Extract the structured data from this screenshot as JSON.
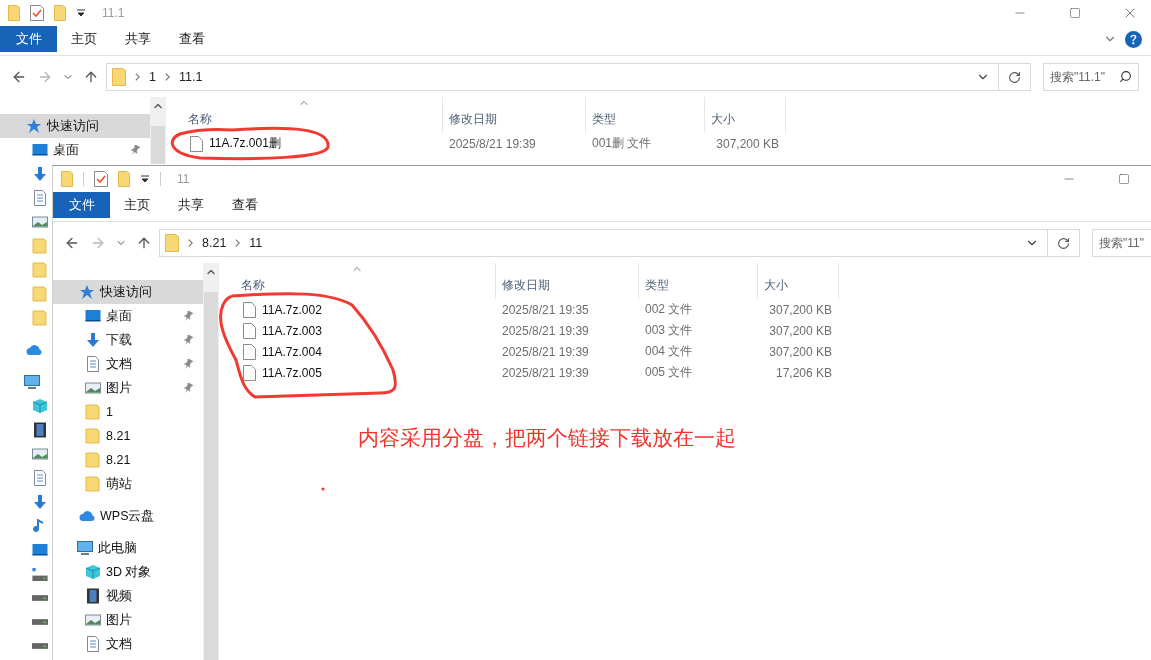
{
  "back_window": {
    "title": "11.1",
    "ribbon_tabs": [
      {
        "label": "文件",
        "selected": true
      },
      {
        "label": "主页",
        "selected": false
      },
      {
        "label": "共享",
        "selected": false
      },
      {
        "label": "查看",
        "selected": false
      }
    ],
    "path": [
      "1",
      "11.1"
    ],
    "search": {
      "placeholder": "搜索\"11.1\""
    },
    "sidebar": [
      {
        "kind": "star",
        "label": "快速访问",
        "selected": true,
        "children": [
          {
            "kind": "desktop",
            "label": "桌面",
            "selected": false,
            "pinned": true
          },
          {
            "kind": "download",
            "selected": false
          },
          {
            "kind": "document",
            "selected": false
          },
          {
            "kind": "picture",
            "selected": false
          },
          {
            "kind": "folder",
            "selected": false
          },
          {
            "kind": "folder",
            "selected": false
          },
          {
            "kind": "folder",
            "selected": false
          },
          {
            "kind": "folder",
            "selected": false
          }
        ]
      },
      {
        "kind": "cloud",
        "selected": false
      },
      {
        "kind": "pc",
        "selected": false,
        "children": [
          {
            "kind": "cube",
            "selected": false
          },
          {
            "kind": "video",
            "selected": false
          },
          {
            "kind": "picture",
            "selected": false
          },
          {
            "kind": "document",
            "selected": false
          },
          {
            "kind": "download",
            "selected": false
          },
          {
            "kind": "music",
            "selected": false
          },
          {
            "kind": "desktop",
            "selected": false
          },
          {
            "kind": "osdrive",
            "selected": false
          },
          {
            "kind": "drive",
            "selected": false
          },
          {
            "kind": "drive",
            "selected": false
          },
          {
            "kind": "drive",
            "selected": false
          }
        ]
      }
    ],
    "columns": [
      "名称",
      "修改日期",
      "类型",
      "大小"
    ],
    "files": [
      {
        "name": "11A.7z.001删",
        "modified": "2025/8/21 19:39",
        "type": "001删 文件",
        "size": "307,200 KB"
      }
    ]
  },
  "front_window": {
    "title": "11",
    "ribbon_tabs": [
      {
        "label": "文件",
        "selected": true
      },
      {
        "label": "主页",
        "selected": false
      },
      {
        "label": "共享",
        "selected": false
      },
      {
        "label": "查看",
        "selected": false
      }
    ],
    "path": [
      "8.21",
      "11"
    ],
    "search": {
      "placeholder": "搜索\"11\""
    },
    "sidebar": [
      {
        "kind": "star",
        "label": "快速访问",
        "selected": true,
        "children": [
          {
            "kind": "desktop",
            "label": "桌面",
            "selected": false,
            "pinned": true
          },
          {
            "kind": "download",
            "label": "下载",
            "selected": false,
            "pinned": true
          },
          {
            "kind": "document",
            "label": "文档",
            "selected": false,
            "pinned": true
          },
          {
            "kind": "picture",
            "label": "图片",
            "selected": false,
            "pinned": true
          },
          {
            "kind": "folder",
            "label": "1",
            "selected": false,
            "pinned": false
          },
          {
            "kind": "folder",
            "label": "8.21",
            "selected": false,
            "pinned": false
          },
          {
            "kind": "folder",
            "label": "8.21",
            "selected": false,
            "pinned": false
          },
          {
            "kind": "folder",
            "label": "萌站",
            "selected": false,
            "pinned": false
          }
        ]
      },
      {
        "kind": "cloud",
        "label": "WPS云盘",
        "selected": false
      },
      {
        "kind": "pc",
        "label": "此电脑",
        "selected": false,
        "children": [
          {
            "kind": "cube",
            "label": "3D 对象",
            "selected": false
          },
          {
            "kind": "video",
            "label": "视频",
            "selected": false
          },
          {
            "kind": "picture",
            "label": "图片",
            "selected": false
          },
          {
            "kind": "document",
            "label": "文档",
            "selected": false
          }
        ]
      }
    ],
    "columns": [
      "名称",
      "修改日期",
      "类型",
      "大小"
    ],
    "files": [
      {
        "name": "11A.7z.002",
        "modified": "2025/8/21 19:35",
        "type": "002 文件",
        "size": "307,200 KB"
      },
      {
        "name": "11A.7z.003",
        "modified": "2025/8/21 19:39",
        "type": "003 文件",
        "size": "307,200 KB"
      },
      {
        "name": "11A.7z.004",
        "modified": "2025/8/21 19:39",
        "type": "004 文件",
        "size": "307,200 KB"
      },
      {
        "name": "11A.7z.005",
        "modified": "2025/8/21 19:39",
        "type": "005 文件",
        "size": "17,206 KB"
      }
    ],
    "annotation": {
      "text": "内容采用分盘，把两个链接下载放在一起"
    }
  }
}
